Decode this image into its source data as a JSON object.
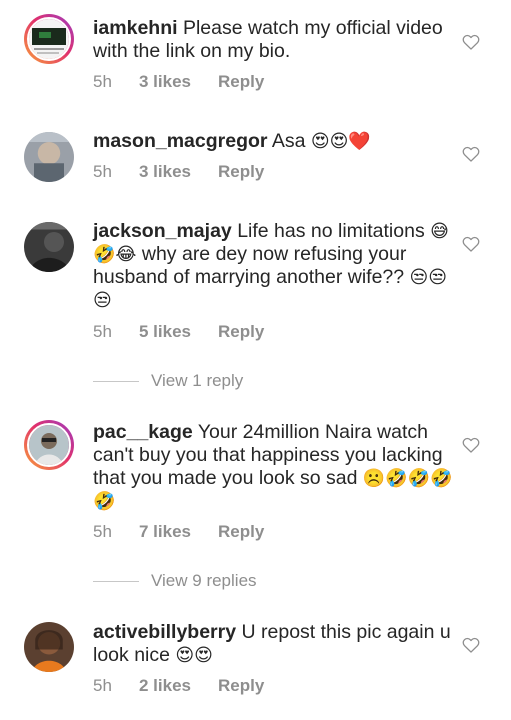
{
  "comments": [
    {
      "username": "iamkehni",
      "text": "Please watch my official video with the link on my bio.",
      "emojis": "",
      "time": "5h",
      "likes": "3 likes",
      "reply": "Reply"
    },
    {
      "username": "mason_macgregor",
      "text": "Asa",
      "emojis": "😍😍❤️",
      "time": "5h",
      "likes": "3 likes",
      "reply": "Reply"
    },
    {
      "username": "jackson_majay",
      "text": "Life has no limitations",
      "emojis": "😅🤣😂",
      "text2": "why are dey now refusing your husband of marrying another wife??",
      "emojis2": "😒😒😒",
      "time": "5h",
      "likes": "5 likes",
      "reply": "Reply",
      "view_replies": "View 1 reply"
    },
    {
      "username": "pac__kage",
      "text": "Your 24million Naira watch can't buy you that happiness you lacking that you made you look so sad",
      "emojis": "☹️🤣🤣🤣🤣",
      "time": "5h",
      "likes": "7 likes",
      "reply": "Reply",
      "view_replies": "View 9 replies"
    },
    {
      "username": "activebillyberry",
      "text": "U repost this pic again u look nice",
      "emojis": "😍😍",
      "time": "5h",
      "likes": "2 likes",
      "reply": "Reply"
    }
  ],
  "icons": {
    "like": "heart-outline-icon"
  },
  "colors": {
    "meta": "#8e8e8e",
    "text": "#262626",
    "story_ring": "#e1306c"
  }
}
